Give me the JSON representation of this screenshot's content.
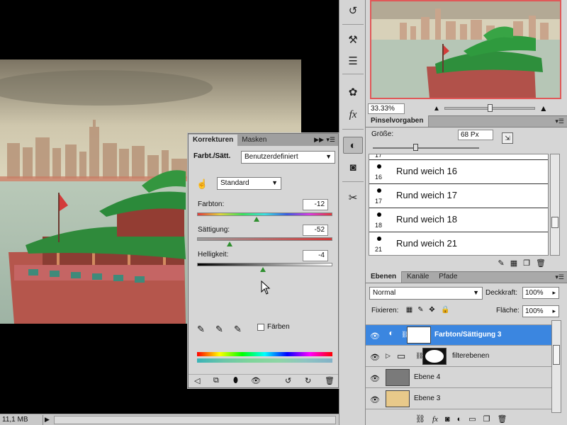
{
  "status": {
    "doc_size": "11,1 MB"
  },
  "navigator": {
    "zoom": "33.33%"
  },
  "brushes": {
    "tab": "Pinselvorgaben",
    "size_label": "Größe:",
    "size_value": "68 Px",
    "partial_number": "17",
    "items": [
      {
        "num": "16",
        "name": "Rund weich 16"
      },
      {
        "num": "17",
        "name": "Rund weich 17"
      },
      {
        "num": "18",
        "name": "Rund weich 18"
      },
      {
        "num": "21",
        "name": "Rund weich 21"
      }
    ]
  },
  "layers": {
    "tabs": [
      "Ebenen",
      "Kanäle",
      "Pfade"
    ],
    "blend_mode": "Normal",
    "opacity_label": "Deckkraft:",
    "opacity": "100%",
    "lock_label": "Fixieren:",
    "fill_label": "Fläche:",
    "fill": "100%",
    "items": [
      {
        "name": "Farbton/Sättigung 3",
        "selected": true
      },
      {
        "name": "filterebenen",
        "selected": false
      },
      {
        "name": "Ebene 4",
        "selected": false
      },
      {
        "name": "Ebene 3",
        "selected": false
      }
    ]
  },
  "adjustments": {
    "tabs": [
      "Korrekturen",
      "Masken"
    ],
    "title": "Farbt./Sätt.",
    "preset": "Benutzerdefiniert",
    "channel": "Standard",
    "hue_label": "Farbton:",
    "hue": "-12",
    "sat_label": "Sättigung:",
    "sat": "-52",
    "light_label": "Helligkeit:",
    "light": "-4",
    "colorize_label": "Färben"
  },
  "colors": {
    "selection": "#3b86e0",
    "nav_border": "#e05858",
    "slider_thumb": "#2f8f2f"
  }
}
